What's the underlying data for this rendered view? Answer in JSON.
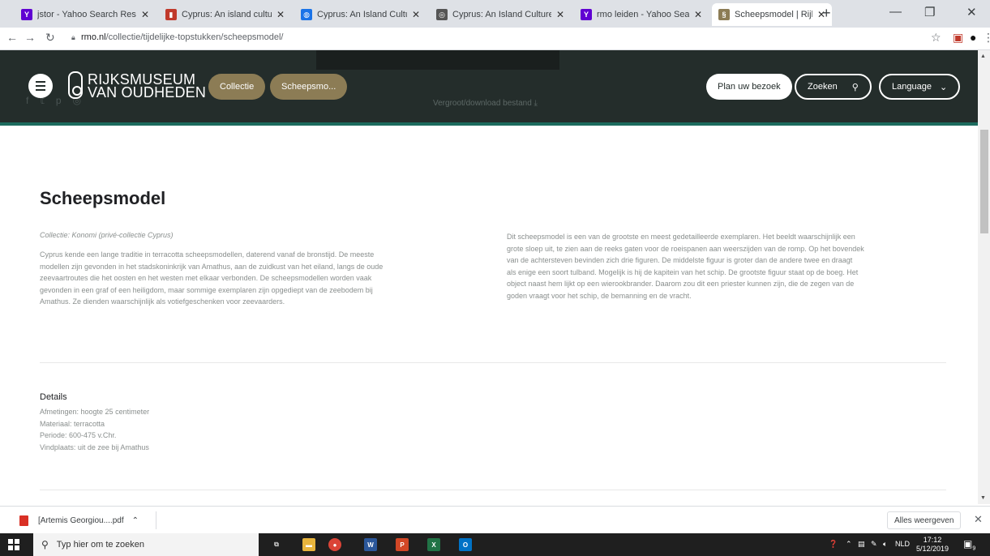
{
  "browser": {
    "tabs": [
      {
        "title": "jstor - Yahoo Search Results",
        "favicon_color": "#6001d2",
        "favicon_glyph": "Y"
      },
      {
        "title": "Cyprus: An island culture: So",
        "favicon_color": "#c0392b",
        "favicon_glyph": "▮"
      },
      {
        "title": "Cyprus: An Island Culture: Sc",
        "favicon_color": "#1a73e8",
        "favicon_glyph": "◍"
      },
      {
        "title": "Cyprus: An Island Culture",
        "favicon_color": "#555555",
        "favicon_glyph": "◎"
      },
      {
        "title": "rmo leiden - Yahoo Search R",
        "favicon_color": "#6001d2",
        "favicon_glyph": "Y"
      },
      {
        "title": "Scheepsmodel | Rijksmuseu",
        "favicon_color": "#8c7c55",
        "favicon_glyph": "§"
      }
    ],
    "active_tab": 5,
    "url_host": "rmo.nl",
    "url_path": "/collectie/tijdelijke-topstukken/scheepsmodel/"
  },
  "header": {
    "logo_line1": "RIJKSMUSEUM",
    "logo_line2": "VAN OUDHEDEN",
    "breadcrumb_1": "Collectie",
    "breadcrumb_2": "Scheepsmo...",
    "vergroot": "Vergroot/download bestand ⤓",
    "plan_button": "Plan uw bezoek",
    "search_button": "Zoeken",
    "language_button": "Language"
  },
  "content": {
    "title": "Scheepsmodel",
    "collectie": "Collectie: Konomi (privé-collectie Cyprus)",
    "left_lines": [
      "Cyprus kende een lange traditie in terracotta scheepsmodellen, daterend vanaf de bronstijd. De meeste",
      "modellen zijn gevonden in het stadskoninkrijk van Amathus, aan de zuidkust van het eiland, langs de oude",
      "zeevaartroutes die het oosten en het westen met elkaar verbonden. De scheepsmodellen worden vaak",
      "gevonden in een graf of een heiligdom, maar sommige exemplaren zijn opgediept van de zeebodem bij",
      "Amathus. Ze dienden waarschijnlijk als votiefgeschenken voor zeevaarders."
    ],
    "right_lines": [
      "Dit scheepsmodel is een van de grootste en meest gedetailleerde exemplaren. Het beeldt waarschijnlijk een",
      "grote sloep uit, te zien aan de reeks gaten voor de roeispanen aan weerszijden van de romp. Op het bovendek",
      "van de achtersteven bevinden zich drie figuren. De middelste figuur is groter dan de andere twee en draagt",
      "als enige een soort tulband. Mogelijk is hij de kapitein van het schip. De grootste figuur staat op de boeg. Het",
      "object naast hem lijkt op een wierookbrander. Daarom zou dit een priester kunnen zijn, die de zegen van de",
      "goden vraagt voor het schip, de bemanning en de vracht."
    ],
    "details_heading": "Details",
    "details": [
      "Afmetingen: hoogte 25 centimeter",
      "Materiaal: terracotta",
      "Periode: 600-475 v.Chr.",
      "Vindplaats: uit de zee bij Amathus"
    ]
  },
  "downloads": {
    "file": "[Artemis Georgiou....pdf",
    "show_all": "Alles weergeven"
  },
  "taskbar": {
    "search_placeholder": "Typ hier om te zoeken",
    "language": "NLD",
    "time": "17:12",
    "date": "5/12/2019",
    "notifications": "9"
  }
}
